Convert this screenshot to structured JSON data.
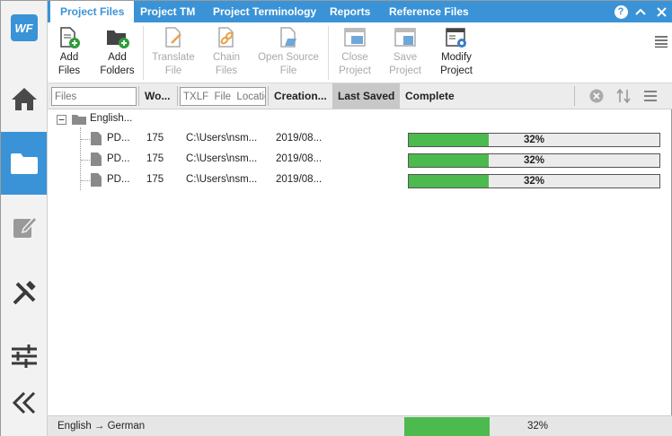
{
  "app": {
    "logo_text": "WF",
    "accent_color": "#3a93d6",
    "progress_color": "#4cba4e"
  },
  "sidebar": {
    "items": [
      {
        "name": "home",
        "icon": "home-icon",
        "active": false
      },
      {
        "name": "projects",
        "icon": "folder-icon",
        "active": true
      },
      {
        "name": "edit",
        "icon": "edit-icon",
        "active": false
      },
      {
        "name": "tools",
        "icon": "tools-icon",
        "active": false
      },
      {
        "name": "settings",
        "icon": "sliders-icon",
        "active": false
      },
      {
        "name": "collapse",
        "icon": "double-chevron-left-icon",
        "active": false
      }
    ]
  },
  "tabs": [
    {
      "label": "Project Files",
      "active": true
    },
    {
      "label": "Project TM",
      "active": false
    },
    {
      "label": "Project Terminology",
      "active": false
    },
    {
      "label": "Reports",
      "active": false
    },
    {
      "label": "Reference Files",
      "active": false
    }
  ],
  "window_controls": {
    "help": "?",
    "collapse": "^",
    "close": "×"
  },
  "ribbon": {
    "add_files": {
      "line1": "Add",
      "line2": "Files"
    },
    "add_folders": {
      "line1": "Add",
      "line2": "Folders"
    },
    "translate_file": {
      "line1": "Translate",
      "line2": "File"
    },
    "chain_files": {
      "line1": "Chain",
      "line2": "Files"
    },
    "open_source_file": {
      "line1": "Open Source",
      "line2": "File"
    },
    "close_project": {
      "line1": "Close",
      "line2": "Project"
    },
    "save_project": {
      "line1": "Save",
      "line2": "Project"
    },
    "modify_project": {
      "line1": "Modify",
      "line2": "Project"
    }
  },
  "columns": {
    "files_placeholder": "Files",
    "words": "Wo...",
    "txlf_placeholder": "TXLF  File  Location",
    "creation": "Creation...",
    "last_saved": "Last Saved",
    "complete": "Complete"
  },
  "tree": {
    "root": {
      "label": "English..."
    },
    "files": [
      {
        "name": "PD...",
        "words": "175",
        "path": "C:\\Users\\nsm...",
        "created": "2019/08...",
        "progress": 0.32,
        "progress_label": "32%"
      },
      {
        "name": "PD...",
        "words": "175",
        "path": "C:\\Users\\nsm...",
        "created": "2019/08...",
        "progress": 0.32,
        "progress_label": "32%"
      },
      {
        "name": "PD...",
        "words": "175",
        "path": "C:\\Users\\nsm...",
        "created": "2019/08...",
        "progress": 0.32,
        "progress_label": "32%"
      }
    ]
  },
  "status": {
    "language_pair": "English → German",
    "progress": 0.32,
    "progress_label": "32%"
  }
}
